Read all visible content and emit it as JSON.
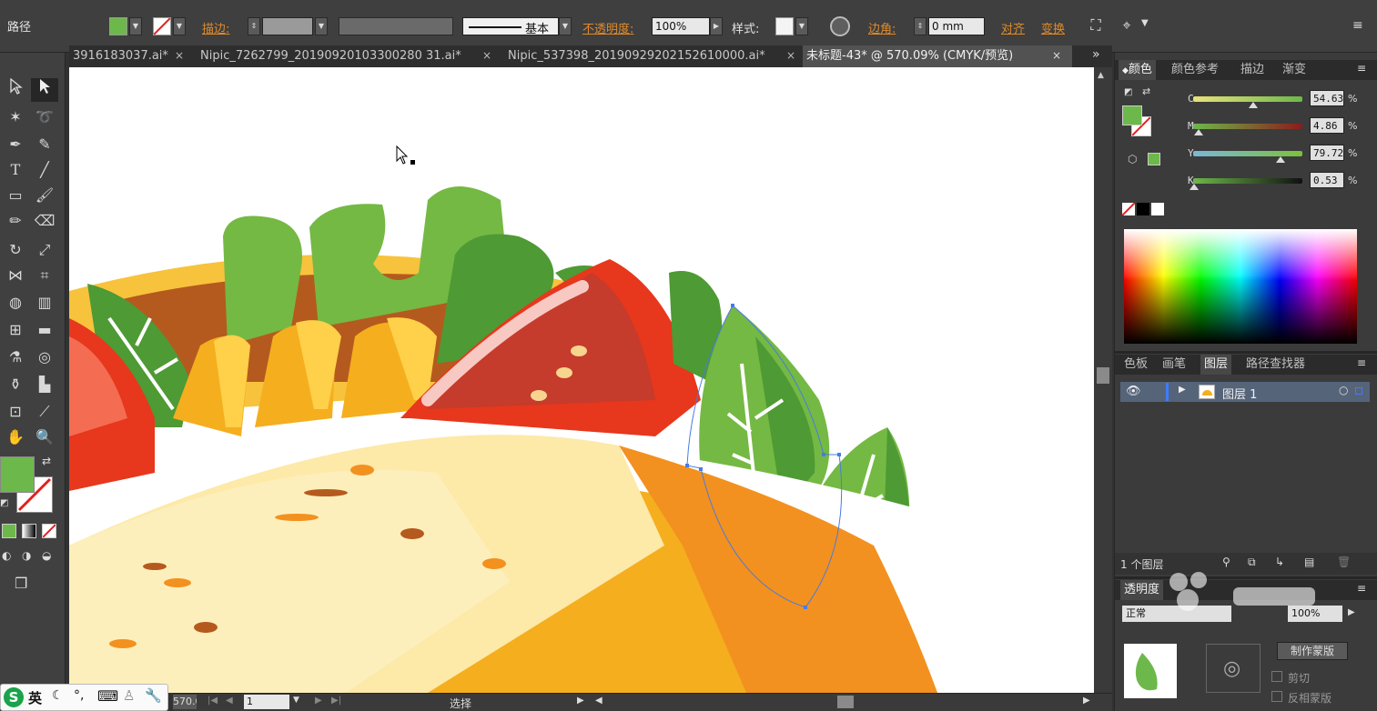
{
  "control_bar": {
    "selection_label": "路径",
    "stroke_label": "描边",
    "stroke_colon": ":",
    "stroke_profile_label": "基本",
    "opacity_label": "不透明度",
    "opacity_colon": ":",
    "opacity_value": "100%",
    "style_label": "样式",
    "style_colon": ":",
    "corner_label": "边角",
    "corner_colon": ":",
    "corner_value": "0 mm",
    "align_label": "对齐",
    "transform_label": "变换",
    "fill_color": "#6db84a"
  },
  "tabs": [
    {
      "label": "3916183037.ai*",
      "active": false
    },
    {
      "label": "Nipic_7262799_20190920103300280 31.ai*",
      "active": false
    },
    {
      "label": "Nipic_537398_20190929202152610000.ai*",
      "active": false
    },
    {
      "label": "未标题-43* @ 570.09% (CMYK/预览)",
      "active": true
    }
  ],
  "tab_close": "×",
  "tab_overflow": "»",
  "color_panel": {
    "tabs": [
      "颜色",
      "颜色参考",
      "描边",
      "渐变"
    ],
    "channels": [
      {
        "name": "C",
        "value": "54.63",
        "percent": 0.5463
      },
      {
        "name": "M",
        "value": "4.86",
        "percent": 0.0486
      },
      {
        "name": "Y",
        "value": "79.72",
        "percent": 0.7972
      },
      {
        "name": "K",
        "value": "0.53",
        "percent": 0.0053
      }
    ],
    "percent_sign": "%"
  },
  "layers_panel": {
    "tabs": [
      "色板",
      "画笔",
      "图层",
      "路径查找器"
    ],
    "layer_name": "图层 1",
    "layer_count": "1 个图层"
  },
  "transparency_panel": {
    "tab": "透明度",
    "mode": "正常",
    "opacity": "100%",
    "make_mask_button": "制作蒙版",
    "clip_label": "剪切",
    "invert_mask_label": "反相蒙版"
  },
  "status_bar": {
    "zoom": "570.09",
    "artboard": "1",
    "tool_name": "选择"
  },
  "ime_bar": {
    "language": "英"
  }
}
